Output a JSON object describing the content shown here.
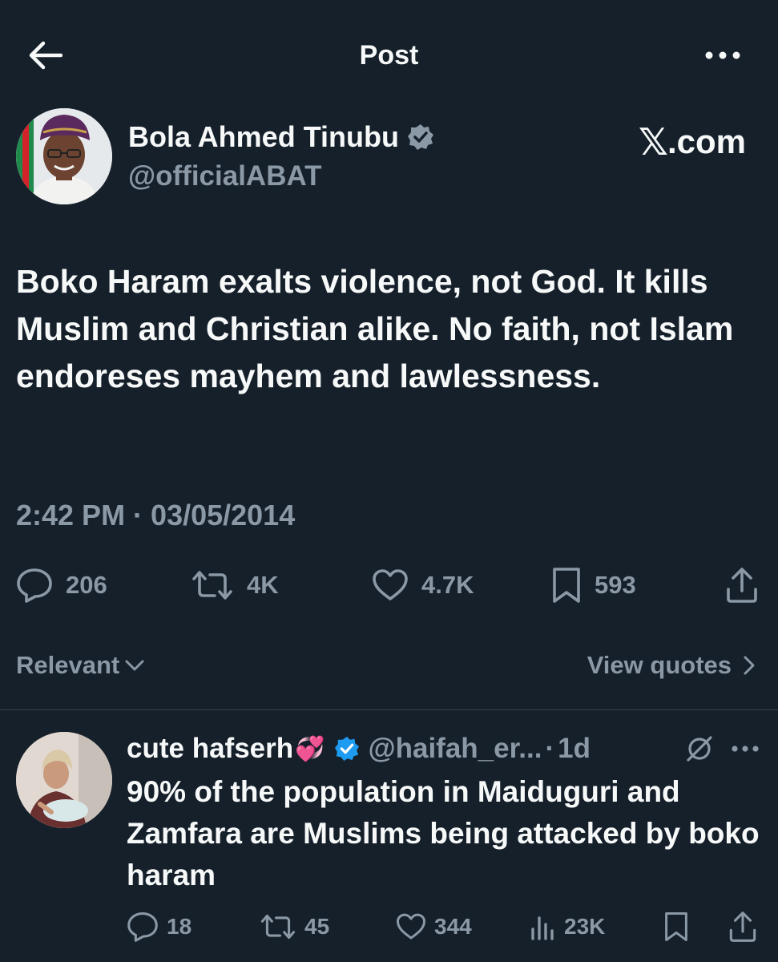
{
  "header": {
    "title": "Post",
    "back_icon": "arrow-left-icon",
    "more_icon": "more-horizontal-icon"
  },
  "post": {
    "author_name": "Bola Ahmed Tinubu",
    "author_handle": "@officialABAT",
    "verified_badge_color": "#8b98a5",
    "site_label_x": "𝕏",
    "site_label_rest": ".com",
    "text": "Boko Haram exalts violence, not God. It kills Muslim and Christian alike. No faith, not Islam endoreses mayhem and lawlessness.",
    "timestamp": "2:42 PM · 03/05/2014",
    "stats": {
      "replies": "206",
      "reposts": "4K",
      "likes": "4.7K",
      "bookmarks": "593"
    }
  },
  "sort": {
    "label": "Relevant",
    "view_quotes": "View quotes"
  },
  "reply": {
    "name": "cute hafserh",
    "emoji": "💞",
    "verified_badge_color": "#1d9bf0",
    "handle": "@haifah_er...",
    "separator": "·",
    "time": "1d",
    "text": "90% of the population in Maiduguri and Zamfara are Muslims being attacked by boko haram",
    "stats": {
      "replies": "18",
      "reposts": "45",
      "likes": "344",
      "views": "23K"
    }
  },
  "colors": {
    "background": "#15202b",
    "text_primary": "#f7f9f9",
    "text_secondary": "#8b98a5",
    "divider": "#38444d",
    "verified_blue": "#1d9bf0"
  }
}
